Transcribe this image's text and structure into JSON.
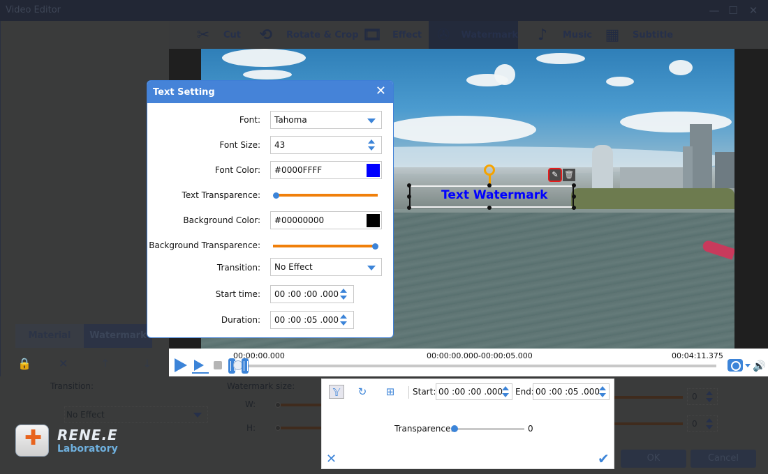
{
  "window": {
    "title": "Video Editor",
    "controls": {
      "minimize": "—",
      "maximize": "☐",
      "close": "✕"
    }
  },
  "toolbar": {
    "tabs": [
      {
        "label": "Cut",
        "icon": "scissors-icon",
        "glyph": "✂",
        "active": false
      },
      {
        "label": "Rotate & Crop",
        "icon": "crop-rotate-icon",
        "glyph": "⟲",
        "active": false
      },
      {
        "label": "Effect",
        "icon": "film-effect-icon",
        "glyph": "🎞",
        "active": false
      },
      {
        "label": "Watermark",
        "icon": "film-reel-watermark-icon",
        "glyph": "✇",
        "active": true
      },
      {
        "label": "Music",
        "icon": "music-note-icon",
        "glyph": "♪",
        "active": false
      },
      {
        "label": "Subtitle",
        "icon": "subtitle-icon",
        "glyph": "▦",
        "active": false
      }
    ]
  },
  "preview": {
    "watermark_text": "Text Watermark",
    "watermark_color": "#0000FF",
    "edit_icon": "✎",
    "delete_icon": "🗑"
  },
  "playback": {
    "current_time": "00:00:00.000",
    "selection_range": "00:00:00.000-00:00:05.000",
    "total_time": "00:04:11.375",
    "volume_icon": "🔊"
  },
  "left_panel": {
    "tabs": [
      {
        "label": "Material",
        "active": false
      },
      {
        "label": "Watermark",
        "active": true
      }
    ],
    "icons": {
      "lock": "🔒",
      "remove": "✕",
      "up": "↑",
      "down": "↓"
    },
    "transition_label": "Transition:",
    "transition_value": "No Effect",
    "watermark_size_label": "Watermark size:",
    "w_label": "W:",
    "h_label": "H:",
    "w_value": "0",
    "h_value": "0",
    "ok_label": "OK",
    "cancel_label": "Cancel"
  },
  "logo": {
    "name": "RENE.E",
    "subtitle": "Laboratory",
    "plus": "✚"
  },
  "text_setting": {
    "title": "Text Setting",
    "close": "✕",
    "font_label": "Font:",
    "font_value": "Tahoma",
    "font_size_label": "Font Size:",
    "font_size_value": "43",
    "font_color_label": "Font Color:",
    "font_color_value": "#0000FFFF",
    "font_color_swatch": "#0000FF",
    "text_transparence_label": "Text Transparence:",
    "text_transparence_value": 0,
    "background_color_label": "Background Color:",
    "background_color_value": "#00000000",
    "background_color_swatch": "#000000",
    "background_transparence_label": "Background Transparence:",
    "background_transparence_value": 100,
    "transition_label": "Transition:",
    "transition_value": "No Effect",
    "start_time_label": "Start time:",
    "start_time_value": "00 :00 :00 .000",
    "duration_label": "Duration:",
    "duration_value": "00 :00 :05 .000"
  },
  "watermark_panel": {
    "tools": [
      {
        "icon": "goblet-transparence-icon",
        "glyph": "𝕐",
        "selected": true
      },
      {
        "icon": "rotate-icon",
        "glyph": "↻",
        "selected": false
      },
      {
        "icon": "fit-grid-icon",
        "glyph": "⊞",
        "selected": false
      }
    ],
    "start_label": "Start:",
    "start_value": "00 :00 :00 .000",
    "end_label": "End:",
    "end_value": "00 :00 :05 .000",
    "transparence_label": "Transparence:",
    "transparence_value": "0",
    "cancel_glyph": "✕",
    "confirm_glyph": "✔"
  },
  "colors": {
    "accent": "#3C84D8",
    "dialog_header": "#4583D8",
    "slider_fill": "#F07F0A",
    "edit_highlight": "#E51C1C",
    "rotate_handle": "#F5A300"
  }
}
